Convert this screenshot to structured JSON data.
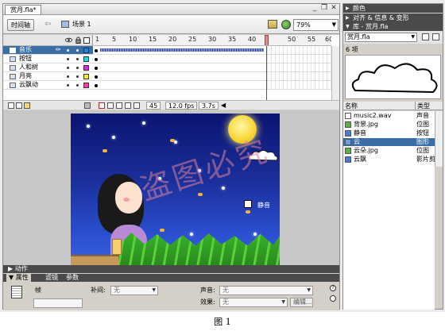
{
  "document": {
    "tab": "赏月.fla*",
    "window_buttons": [
      "_",
      "❐",
      "✕"
    ],
    "timeline_button": "时间轴",
    "back_arrow": "⇦",
    "scene": "场景 1",
    "zoom": "79%"
  },
  "timeline": {
    "frame_ticks": [
      "1",
      "5",
      "10",
      "15",
      "20",
      "25",
      "30",
      "35",
      "40",
      "45",
      "50",
      "55",
      "60"
    ],
    "layers": [
      {
        "name": "音乐",
        "pencil": "✏",
        "color": "#2a7fd6",
        "selected": true,
        "audio": true
      },
      {
        "name": "按钮",
        "pencil": "",
        "color": "#22d6e0",
        "selected": false,
        "audio": false
      },
      {
        "name": "人和树",
        "pencil": "",
        "color": "#d62ad6",
        "selected": false,
        "audio": false
      },
      {
        "name": "月亮",
        "pencil": "",
        "color": "#f0f020",
        "selected": false,
        "audio": false
      },
      {
        "name": "云飘动",
        "pencil": "",
        "color": "#ff40a0",
        "selected": false,
        "audio": false
      }
    ],
    "current_frame": "45",
    "fps": "12.0 fps",
    "elapsed": "3.7s"
  },
  "stage": {
    "mute_label": "静音",
    "watermark": "盗图必究"
  },
  "panels": {
    "actions": "▶ 动作",
    "tabs": [
      "▼ 属性",
      "滤镜",
      "参数"
    ],
    "tween_label": "补间:",
    "tween_value": "无",
    "sound_label": "声音:",
    "sound_value": "无",
    "effect_label": "效果:",
    "effect_value": "无",
    "edit_button": "编辑...",
    "frame_label": "帧"
  },
  "right": {
    "color_panel": "颜色",
    "align_panel": "对齐 & 信息 & 变形",
    "library_panel": "库 - 赏月.fla",
    "library_select": "赏月.fla",
    "item_count": "6 项",
    "col_name": "名称",
    "col_type": "类型",
    "items": [
      {
        "name": "music2.wav",
        "type": "声音",
        "icon_color": "#ffffff"
      },
      {
        "name": "背景.jpg",
        "type": "位图",
        "icon_color": "#5fae4a"
      },
      {
        "name": "静音",
        "type": "按钮",
        "icon_color": "#4a7ad6"
      },
      {
        "name": "云",
        "type": "图形",
        "icon_color": "#6fa0e0"
      },
      {
        "name": "云朵.jpg",
        "type": "位图",
        "icon_color": "#5fae4a"
      },
      {
        "name": "云飘",
        "type": "影片剪",
        "icon_color": "#4a7ad6"
      }
    ]
  },
  "caption": "图 1"
}
